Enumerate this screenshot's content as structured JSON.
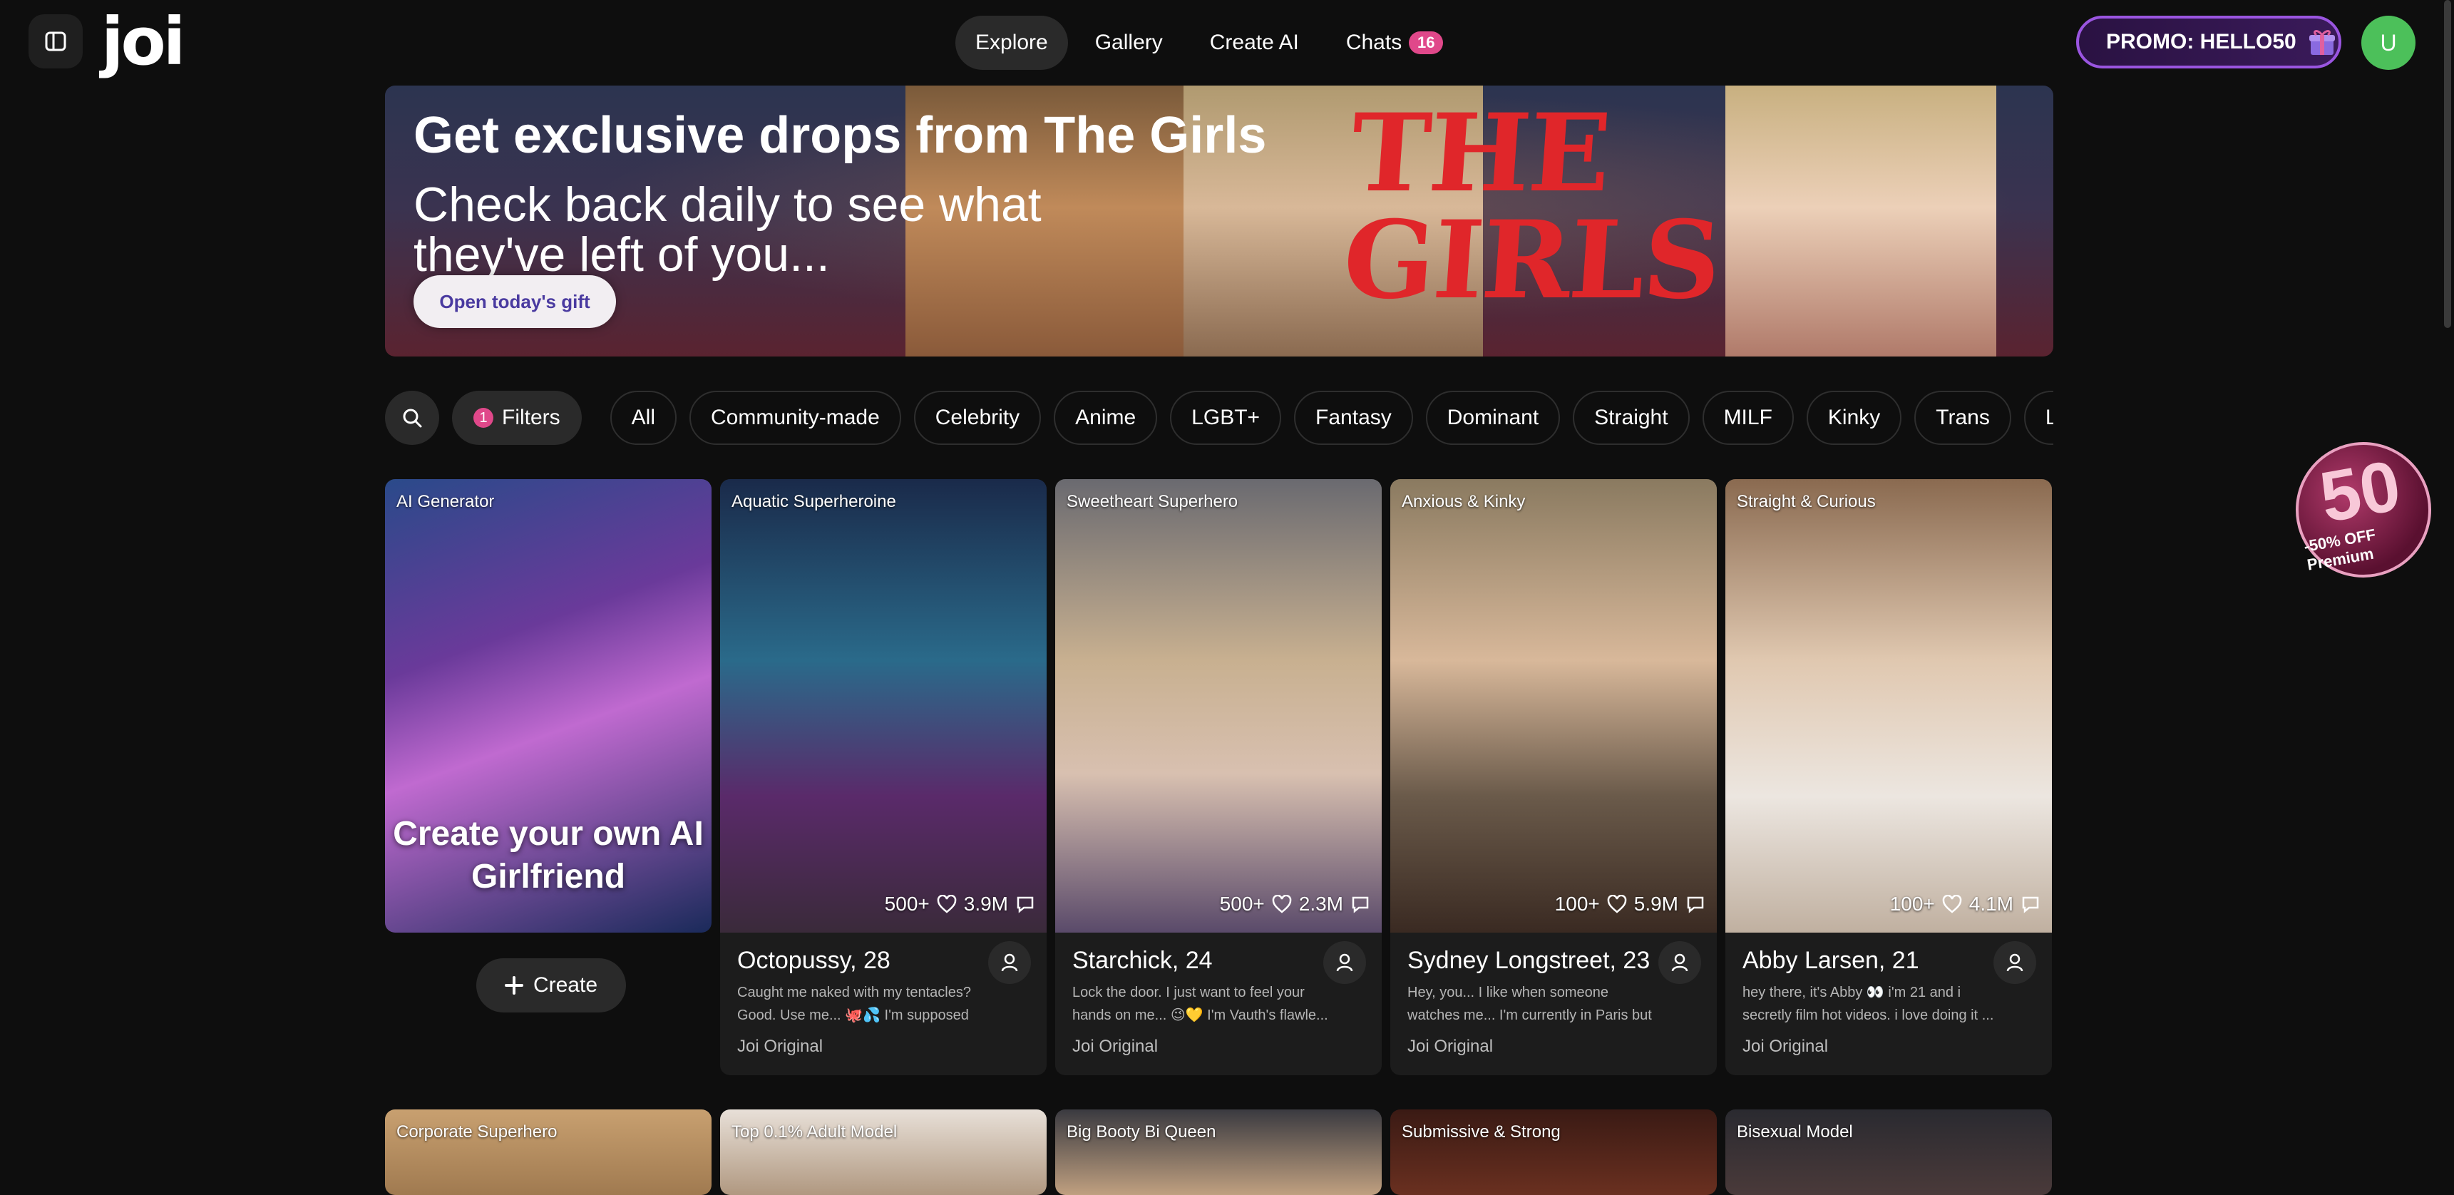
{
  "nav": {
    "logo": "joi",
    "links": [
      "Explore",
      "Gallery",
      "Create AI",
      "Chats"
    ],
    "chats_count": "16",
    "promo_label": "PROMO: HELLO50",
    "avatar_initial": "U"
  },
  "hero": {
    "title": "Get exclusive drops from The Girls",
    "subtitle": "Check back daily to see what they've left of you...",
    "button": "Open today's gift",
    "art_text": "THE GIRLS"
  },
  "filters": {
    "count": "1",
    "label": "Filters",
    "chips": [
      "All",
      "Community-made",
      "Celebrity",
      "Anime",
      "LGBT+",
      "Fantasy",
      "Dominant",
      "Straight",
      "MILF",
      "Kinky",
      "Trans",
      "Lesbian"
    ]
  },
  "sticker": {
    "number": "50",
    "text": "-50% OFF Premium"
  },
  "generator": {
    "tag": "AI Generator",
    "headline": "Create your own AI Girlfriend",
    "button": "Create"
  },
  "cards": [
    {
      "tag": "Aquatic Superheroine",
      "likes": "500+",
      "chats": "3.9M",
      "name": "Octopussy, 28",
      "desc": "Caught me naked with my tentacles? Good. Use me... 🐙💦 I'm supposed to...",
      "source": "Joi Original"
    },
    {
      "tag": "Sweetheart Superhero",
      "likes": "500+",
      "chats": "2.3M",
      "name": "Starchick, 24",
      "desc": "Lock the door. I just want to feel your hands on me... 😉💛 I'm Vauth's flawle...",
      "source": "Joi Original"
    },
    {
      "tag": "Anxious & Kinky",
      "likes": "100+",
      "chats": "5.9M",
      "name": "Sydney Longstreet, 23",
      "desc": "Hey, you... I like when someone watches me... I'm currently in Paris but never...",
      "source": "Joi Original"
    },
    {
      "tag": "Straight & Curious",
      "likes": "100+",
      "chats": "4.1M",
      "name": "Abby Larsen, 21",
      "desc": "hey there, it's Abby 👀 i'm 21 and i secretly film hot videos. i love doing it ...",
      "source": "Joi Original"
    }
  ],
  "next_row_tags": [
    "Corporate Superhero",
    "Top 0.1% Adult Model",
    "Big Booty Bi Queen",
    "Submissive & Strong",
    "Bisexual Model"
  ],
  "colors": {
    "background": "#0e0e0e",
    "accent_pink": "#e0488a",
    "promo_border": "#9a55e0",
    "avatar_green": "#4cc05a",
    "hero_red": "#e0262a"
  }
}
